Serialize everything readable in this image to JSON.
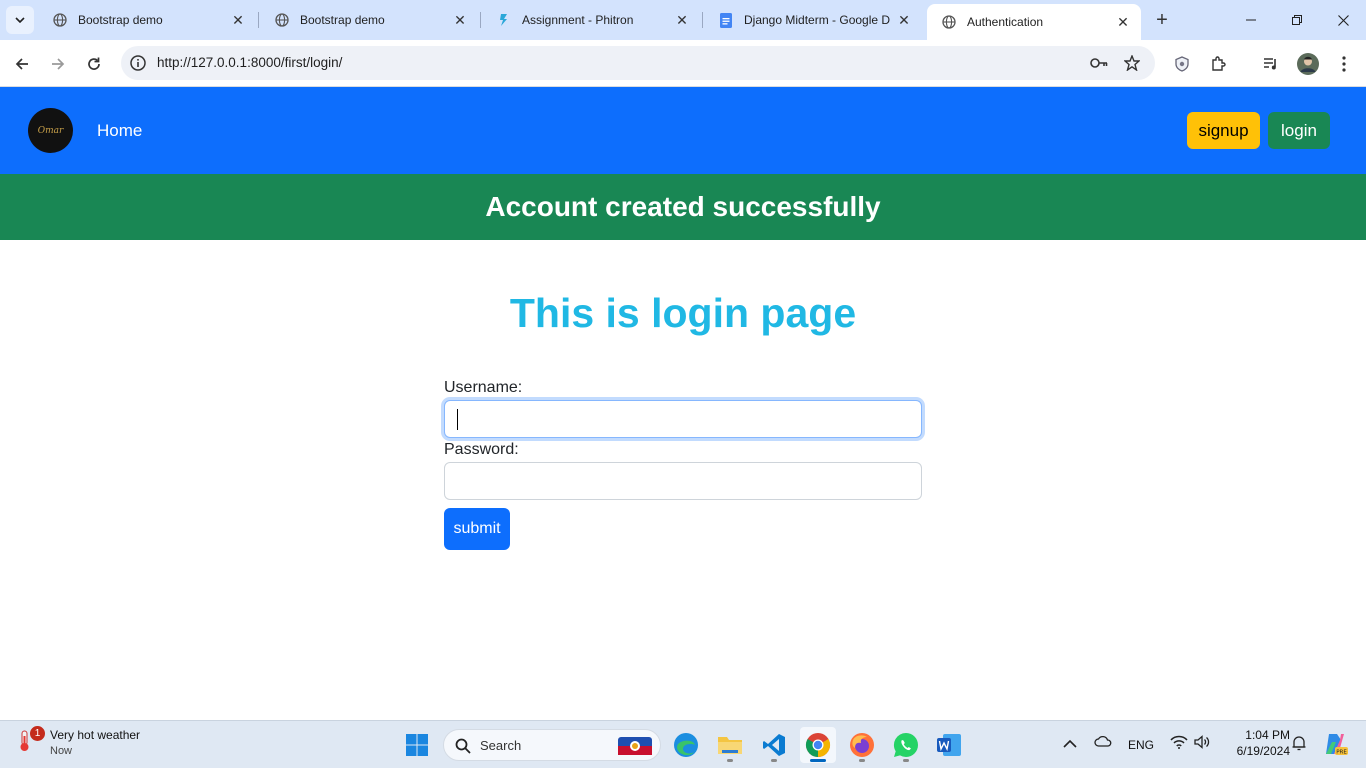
{
  "browser": {
    "tabs": [
      {
        "title": "Bootstrap demo",
        "icon": "globe-icon"
      },
      {
        "title": "Bootstrap demo",
        "icon": "globe-icon"
      },
      {
        "title": "Assignment - Phitron",
        "icon": "phitron-icon"
      },
      {
        "title": "Django Midterm - Google D",
        "icon": "google-docs-icon"
      },
      {
        "title": "Authentication",
        "icon": "globe-icon",
        "active": true
      }
    ],
    "url": "http://127.0.0.1:8000/first/login/"
  },
  "navbar": {
    "logo_text": "Omar",
    "home_label": "Home",
    "signup_label": "signup",
    "login_label": "login"
  },
  "alert": {
    "message": "Account created successfully"
  },
  "main": {
    "title": "This is login page",
    "username_label": "Username:",
    "username_value": "",
    "password_label": "Password:",
    "password_value": "",
    "submit_label": "submit"
  },
  "taskbar": {
    "weather_title": "Very hot weather",
    "weather_sub": "Now",
    "weather_badge": "1",
    "search_label": "Search",
    "language": "ENG",
    "time": "1:04 PM",
    "date": "6/19/2024"
  },
  "colors": {
    "navbar": "#0d6efd",
    "alert": "#198754",
    "title": "#20b8e4",
    "signup": "#ffc107",
    "login": "#198754"
  }
}
